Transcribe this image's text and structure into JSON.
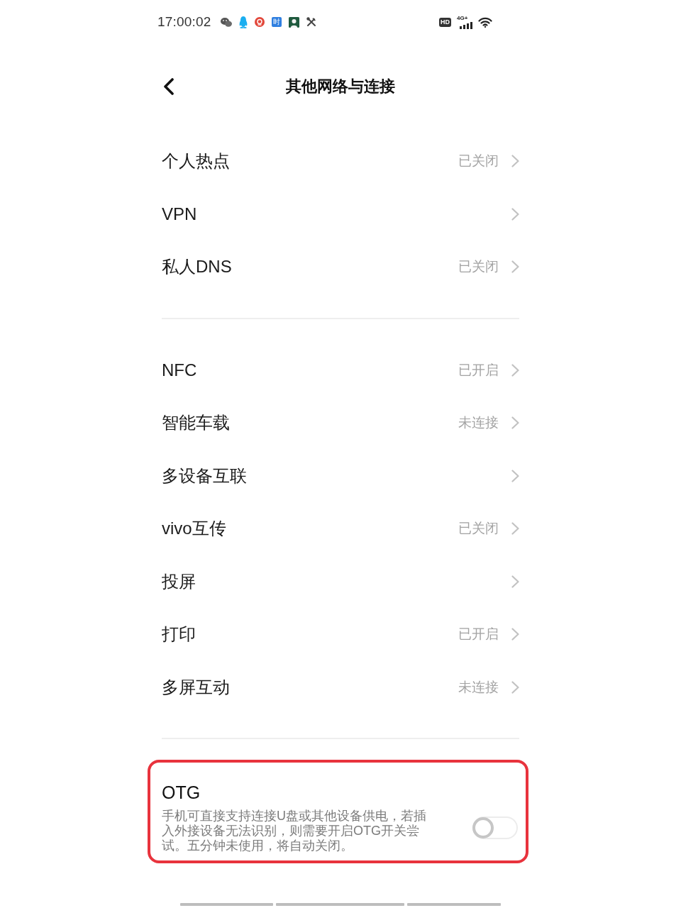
{
  "status_bar": {
    "time": "17:00:02",
    "notifications": [
      {
        "kind": "chat"
      },
      {
        "kind": "penguin"
      },
      {
        "kind": "circle"
      },
      {
        "kind": "tile",
        "glyph": "时"
      },
      {
        "kind": "avatar"
      },
      {
        "kind": "tools"
      }
    ],
    "hd": "HD",
    "network": "4G+"
  },
  "header": {
    "title": "其他网络与连接"
  },
  "sections": [
    {
      "items": [
        {
          "label": "个人热点",
          "value": "已关闭"
        },
        {
          "label": "VPN"
        },
        {
          "label": "私人DNS",
          "value": "已关闭"
        }
      ]
    },
    {
      "items": [
        {
          "label": "NFC",
          "value": "已开启"
        },
        {
          "label": "智能车载",
          "value": "未连接"
        },
        {
          "label": "多设备互联"
        },
        {
          "label": "vivo互传",
          "value": "已关闭"
        },
        {
          "label": "投屏"
        },
        {
          "label": "打印",
          "value": "已开启"
        },
        {
          "label": "多屏互动",
          "value": "未连接"
        }
      ]
    }
  ],
  "otg": {
    "title": "OTG",
    "description": "手机可直接支持连接U盘或其他设备供电，若插入外接设备无法识别，则需要开启OTG开关尝试。五分钟未使用，将自动关闭。",
    "on": false,
    "highlighted": true
  }
}
